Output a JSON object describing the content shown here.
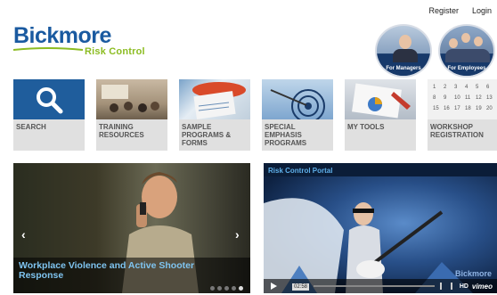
{
  "header": {
    "register": "Register",
    "login": "Login",
    "logo_main": "Bickmore",
    "logo_sub": "Risk Control",
    "for_managers": "For Managers",
    "for_employees": "For Employees"
  },
  "tiles": [
    {
      "label": "SEARCH"
    },
    {
      "label": "TRAINING RESOURCES"
    },
    {
      "label": "SAMPLE PROGRAMS & FORMS"
    },
    {
      "label": "SPECIAL EMPHASIS PROGRAMS"
    },
    {
      "label": "MY TOOLS"
    },
    {
      "label": "WORKSHOP REGISTRATION"
    }
  ],
  "slider": {
    "caption": "Workplace Violence and Active Shooter Response",
    "dots": 5,
    "active_dot": 4
  },
  "video": {
    "title": "Risk Control Portal",
    "time": "02:58",
    "hd": "HD",
    "brand": "vimeo",
    "watermark": "Bickmore"
  },
  "colors": {
    "brand_blue": "#1a5aa0",
    "brand_green": "#8cbc22",
    "caption_blue": "#7fc4f0",
    "tile_gray": "#e0e0e0"
  }
}
